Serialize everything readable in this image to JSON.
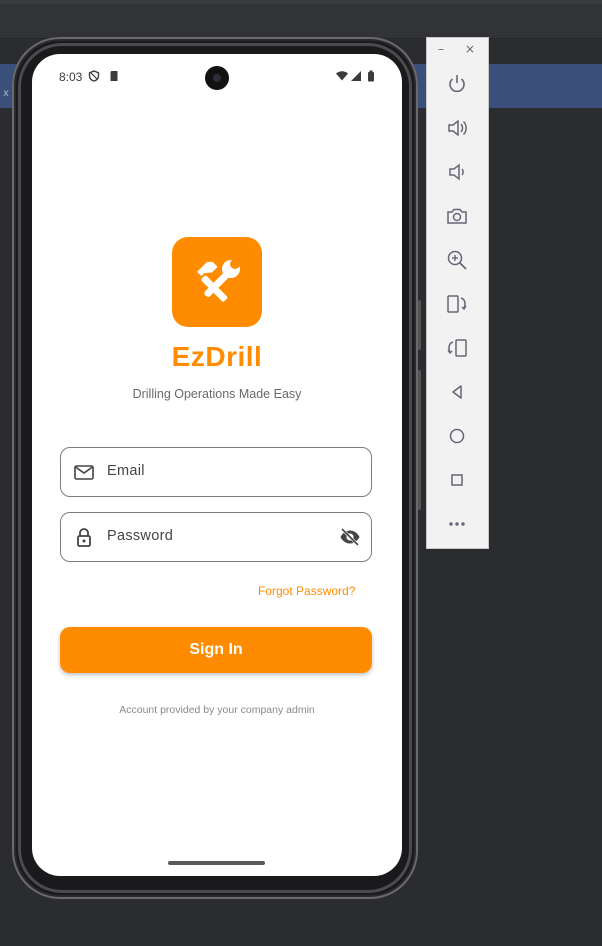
{
  "status_bar": {
    "time": "8:03"
  },
  "app": {
    "title": "EzDrill",
    "subtitle": "Drilling Operations Made Easy",
    "logo_icon": "tools-icon",
    "accent_color": "#ff8c00"
  },
  "form": {
    "email_label": "Email",
    "password_label": "Password",
    "forgot_label": "Forgot Password?",
    "signin_label": "Sign In",
    "footnote": "Account provided by your company admin"
  },
  "emulator_toolbar": {
    "minimize": "–",
    "close": "×",
    "buttons": [
      "power-icon",
      "volume-up-icon",
      "volume-down-icon",
      "camera-icon",
      "zoom-icon",
      "rotate-left-icon",
      "rotate-right-icon",
      "back-icon",
      "home-icon",
      "overview-icon",
      "more-icon"
    ]
  },
  "ide": {
    "tab_close": "x"
  }
}
